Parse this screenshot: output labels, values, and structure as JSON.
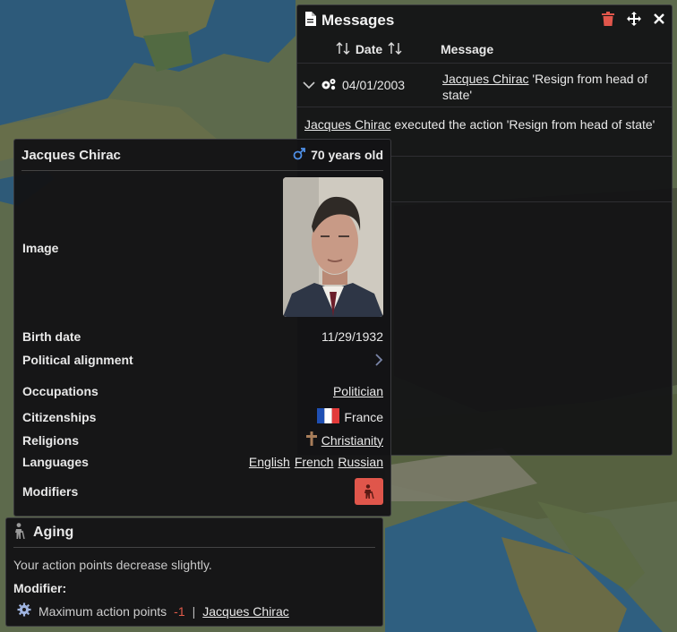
{
  "messages": {
    "title": "Messages",
    "columns": {
      "date": "Date",
      "message": "Message"
    },
    "rows": [
      {
        "date": "04/01/2003",
        "actor": "Jacques Chirac",
        "text": "'Resign from head of state'",
        "detail_actor": "Jacques Chirac",
        "detail_text": "executed the action 'Resign from head of state'"
      }
    ]
  },
  "character": {
    "name": "Jacques Chirac",
    "age": "70 years old",
    "image_label": "Image",
    "birth_date_label": "Birth date",
    "birth_date": "11/29/1932",
    "political_label": "Political alignment",
    "occupations_label": "Occupations",
    "occupation": "Politician",
    "citizenships_label": "Citizenships",
    "citizenship": "France",
    "religions_label": "Religions",
    "religion": "Christianity",
    "languages_label": "Languages",
    "languages": [
      "English",
      "French",
      "Russian"
    ],
    "modifiers_label": "Modifiers"
  },
  "aging": {
    "title": "Aging",
    "description": "Your action points decrease slightly.",
    "modifier_label": "Modifier:",
    "effect": "Maximum action points",
    "value": "-1",
    "separator": "|",
    "source": "Jacques Chirac"
  },
  "icons": {
    "document": "document-icon",
    "trash": "trash-icon",
    "move": "move-icon",
    "close": "close-icon",
    "sort": "sort-icon",
    "chevron": "chevron-down-icon",
    "gears": "gears-icon",
    "male": "male-icon",
    "flag": "france-flag-icon",
    "cross": "cross-icon",
    "elder": "elderly-icon",
    "gear": "gear-icon"
  },
  "colors": {
    "accent_red": "#e0564b",
    "male_blue": "#4f8fe6",
    "negative": "#e25b4a",
    "flag_blue": "#1f4fb3",
    "flag_red": "#e23a3a"
  }
}
